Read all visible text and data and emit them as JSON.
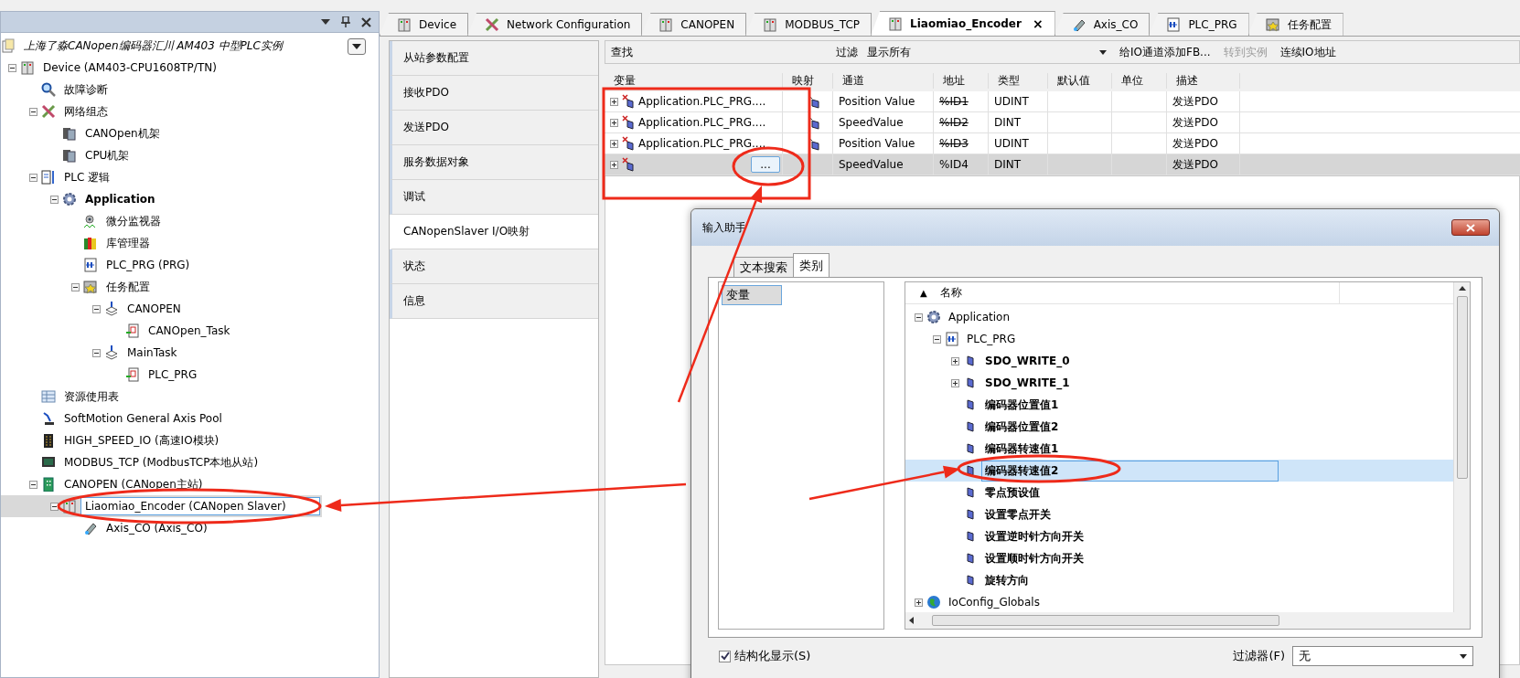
{
  "explorer": {
    "project": "上海了淼CANopen编码器汇川 AM403 中型PLC实例",
    "tree": [
      {
        "label": "Device (AM403-CPU1608TP/TN)",
        "kind": "device",
        "expanded": true,
        "selected": false,
        "children": [
          {
            "label": "故障诊断",
            "kind": "diagnose",
            "selected": false
          },
          {
            "label": "网络组态",
            "kind": "network",
            "expanded": true,
            "selected": false,
            "children": [
              {
                "label": "CANOpen机架",
                "kind": "rack",
                "selected": false
              },
              {
                "label": "CPU机架",
                "kind": "rack",
                "selected": false
              }
            ]
          },
          {
            "label": "PLC 逻辑",
            "kind": "logic",
            "expanded": true,
            "selected": false,
            "children": [
              {
                "label": "Application",
                "kind": "gear",
                "active": true,
                "expanded": true,
                "selected": false,
                "children": [
                  {
                    "label": "微分监视器",
                    "kind": "monitor",
                    "selected": false
                  },
                  {
                    "label": "库管理器",
                    "kind": "library",
                    "selected": false
                  },
                  {
                    "label": "PLC_PRG (PRG)",
                    "kind": "pou",
                    "selected": false
                  },
                  {
                    "label": "任务配置",
                    "kind": "tasks",
                    "expanded": true,
                    "selected": false,
                    "children": [
                      {
                        "label": "CANOPEN",
                        "kind": "task",
                        "expanded": true,
                        "selected": false,
                        "children": [
                          {
                            "label": "CANOpen_Task",
                            "kind": "call",
                            "selected": false
                          }
                        ]
                      },
                      {
                        "label": "MainTask",
                        "kind": "task",
                        "expanded": true,
                        "selected": false,
                        "children": [
                          {
                            "label": "PLC_PRG",
                            "kind": "call",
                            "selected": false
                          }
                        ]
                      }
                    ]
                  }
                ]
              }
            ]
          },
          {
            "label": "资源使用表",
            "kind": "table",
            "selected": false
          },
          {
            "label": "SoftMotion General Axis Pool",
            "kind": "axispool",
            "selected": false
          },
          {
            "label": "HIGH_SPEED_IO (高速IO模块)",
            "kind": "io",
            "selected": false
          },
          {
            "label": "MODBUS_TCP (ModbusTCP本地从站)",
            "kind": "ethernet",
            "selected": false
          },
          {
            "label": "CANOPEN (CANopen主站)",
            "kind": "canopen",
            "expanded": true,
            "selected": false,
            "children": [
              {
                "label": "Liaomiao_Encoder (CANopen Slaver)",
                "kind": "device",
                "expanded": true,
                "selected": true,
                "children": [
                  {
                    "label": "Axis_CO (Axis_CO)",
                    "kind": "axis",
                    "selected": false
                  }
                ]
              }
            ]
          }
        ]
      }
    ]
  },
  "tabs": [
    {
      "label": "Device",
      "kind": "device",
      "selected": false
    },
    {
      "label": "Network Configuration",
      "kind": "network",
      "selected": false
    },
    {
      "label": "CANOPEN",
      "kind": "device",
      "selected": false
    },
    {
      "label": "MODBUS_TCP",
      "kind": "device",
      "selected": false
    },
    {
      "label": "Liaomiao_Encoder",
      "kind": "device",
      "selected": true,
      "close": "×"
    },
    {
      "label": "Axis_CO",
      "kind": "axis",
      "selected": false
    },
    {
      "label": "PLC_PRG",
      "kind": "pou",
      "selected": false
    },
    {
      "label": "任务配置",
      "kind": "tasks",
      "selected": false
    }
  ],
  "side_tabs": [
    {
      "label": "从站参数配置",
      "selected": false
    },
    {
      "label": "接收PDO",
      "selected": false
    },
    {
      "label": "发送PDO",
      "selected": false
    },
    {
      "label": "服务数据对象",
      "selected": false
    },
    {
      "label": "调试",
      "selected": false
    },
    {
      "label": "CANopenSlaver I/O映射",
      "selected": true
    },
    {
      "label": "状态",
      "selected": false
    },
    {
      "label": "信息",
      "selected": false
    }
  ],
  "toolbar": {
    "find_label": "查找",
    "filter_label": "过滤",
    "filter_value": "显示所有",
    "buttons": [
      {
        "label": "给IO通道添加FB...",
        "disabled": false
      },
      {
        "label": "转到实例",
        "disabled": true
      },
      {
        "label": "连续IO地址",
        "disabled": false
      }
    ]
  },
  "table": {
    "columns": [
      "变量",
      "映射",
      "通道",
      "地址",
      "类型",
      "默认值",
      "单位",
      "描述"
    ],
    "rows": [
      {
        "variable": "Application.PLC_PRG....",
        "mapped": true,
        "channel": "Position Value",
        "address": "%ID1",
        "struck_out": true,
        "type": "UDINT",
        "description": "发送PDO",
        "selected": false
      },
      {
        "variable": "Application.PLC_PRG....",
        "mapped": true,
        "channel": "SpeedValue",
        "address": "%ID2",
        "struck_out": true,
        "type": "DINT",
        "description": "发送PDO",
        "selected": false
      },
      {
        "variable": "Application.PLC_PRG....",
        "mapped": true,
        "channel": "Position Value",
        "address": "%ID3",
        "struck_out": true,
        "type": "UDINT",
        "description": "发送PDO",
        "selected": false
      },
      {
        "variable": "",
        "browse": "...",
        "mapped": false,
        "channel": "SpeedValue",
        "address": "%ID4",
        "struck_out": false,
        "type": "DINT",
        "description": "发送PDO",
        "selected": true
      }
    ]
  },
  "dialog": {
    "title": "输入助手",
    "tabs": [
      {
        "label": "文本搜索",
        "selected": false
      },
      {
        "label": "类别",
        "selected": true
      }
    ],
    "categories": [
      {
        "label": "变量",
        "selected": true
      }
    ],
    "tree_header": "名称",
    "sort_arrow": "▲",
    "tree": [
      {
        "label": "Application",
        "kind": "gear",
        "expanded": true,
        "selected": false,
        "children": [
          {
            "label": "PLC_PRG",
            "kind": "pou",
            "expanded": true,
            "selected": false,
            "children": [
              {
                "label": "SDO_WRITE_0",
                "kind": "var",
                "expanded": false,
                "selected": false
              },
              {
                "label": "SDO_WRITE_1",
                "kind": "var",
                "expanded": false,
                "selected": false
              },
              {
                "label": "编码器位置值1",
                "kind": "var",
                "selected": false
              },
              {
                "label": "编码器位置值2",
                "kind": "var",
                "selected": false
              },
              {
                "label": "编码器转速值1",
                "kind": "var",
                "selected": false
              },
              {
                "label": "编码器转速值2",
                "kind": "var",
                "selected": true
              },
              {
                "label": "零点预设值",
                "kind": "var",
                "selected": false
              },
              {
                "label": "设置零点开关",
                "kind": "var",
                "selected": false
              },
              {
                "label": "设置逆时针方向开关",
                "kind": "var",
                "selected": false
              },
              {
                "label": "设置顺时针方向开关",
                "kind": "var",
                "selected": false
              },
              {
                "label": "旋转方向",
                "kind": "var",
                "selected": false
              }
            ]
          }
        ]
      },
      {
        "label": "IoConfig_Globals",
        "kind": "globe",
        "expanded": false,
        "selected": false
      }
    ],
    "structured": {
      "label": "结构化显示(S)",
      "checked": true
    },
    "filter": {
      "label": "过滤器(F)",
      "value": "无"
    }
  }
}
